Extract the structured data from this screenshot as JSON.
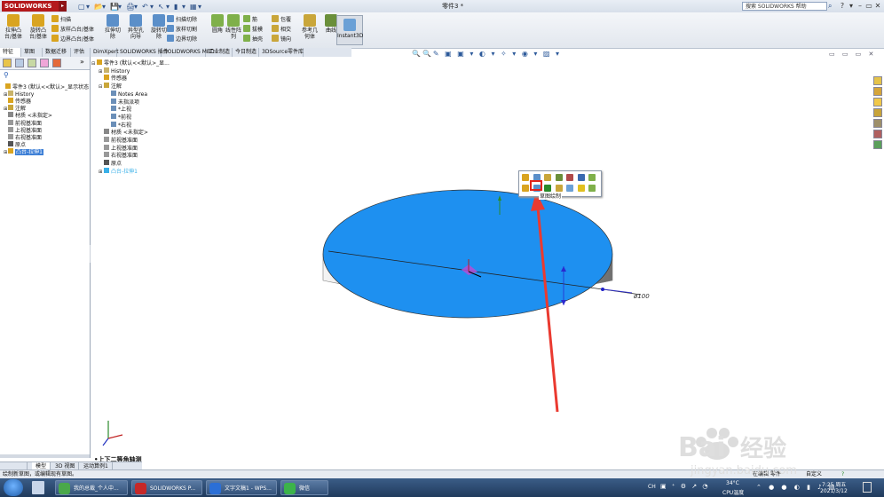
{
  "titlebar": {
    "app_name": "SOLIDWORKS",
    "doc_title": "零件3 *",
    "help_search": "搜索 SOLIDWORKS 帮助",
    "quick_icons": [
      "▢",
      "▾",
      "📂",
      "▾",
      "💾",
      "▾",
      "🖨",
      "▾",
      "↶",
      "▾",
      "↖",
      "▾",
      "▮",
      "▾",
      "▦",
      "▾"
    ],
    "win_controls": [
      "?",
      "▾",
      "–",
      "▭",
      "✕"
    ]
  },
  "cmdbar": {
    "big_tools": [
      {
        "label1": "拉伸凸",
        "label2": "台/基体",
        "color": "#d9a420"
      },
      {
        "label1": "旋转凸",
        "label2": "台/基体",
        "color": "#d9a420"
      },
      {
        "label1": "拉伸切",
        "label2": "除",
        "color": "#5b8fc9"
      },
      {
        "label1": "异型孔",
        "label2": "向导",
        "color": "#5b8fc9"
      },
      {
        "label1": "旋转切",
        "label2": "除",
        "color": "#5b8fc9"
      },
      {
        "label1": "圆角",
        "label2": "",
        "color": "#7fb04a"
      },
      {
        "label1": "线性阵",
        "label2": "列",
        "color": "#7fb04a"
      },
      {
        "label1": "参考几",
        "label2": "何体",
        "color": "#c9a63a"
      },
      {
        "label1": "曲线",
        "label2": "",
        "color": "#6a8f3a"
      }
    ],
    "small_tools": [
      {
        "label": "扫描",
        "color": "#d9a420"
      },
      {
        "label": "放样凸台/基体",
        "color": "#d9a420"
      },
      {
        "label": "边界凸台/基体",
        "color": "#d9a420"
      },
      {
        "label": "扫描切除",
        "color": "#5b8fc9"
      },
      {
        "label": "放样切割",
        "color": "#5b8fc9"
      },
      {
        "label": "边界切除",
        "color": "#5b8fc9"
      },
      {
        "label": "筋",
        "color": "#7fb04a"
      },
      {
        "label": "拔模",
        "color": "#7fb04a"
      },
      {
        "label": "抽壳",
        "color": "#7fb04a"
      },
      {
        "label": "包覆",
        "color": "#c9a63a"
      },
      {
        "label": "相交",
        "color": "#c9a63a"
      },
      {
        "label": "镜向",
        "color": "#c9a63a"
      }
    ],
    "instant3d": "Instant3D"
  },
  "tabs": [
    "特征",
    "草图",
    "数据迁移",
    "评估",
    "DimXpert",
    "SOLIDWORKS 插件",
    "SOLIDWORKS MBD",
    "工业制造",
    "今日制造",
    "3DSource零件库"
  ],
  "hud_icons": "🔍🔍✎ ▣ ▣ ▾ ◐ ▾ ✧ ▾ ◉ ▾ ▨ ▾",
  "viewport_controls": "▭ ▭ ▭ ✕",
  "left_tree": [
    {
      "label": "零件3 (默认<<默认>_显示状态",
      "indent": 0,
      "expander": "",
      "color": "#d9a420",
      "sel": false
    },
    {
      "label": "History",
      "indent": 1,
      "expander": "⊞",
      "color": "#c9b36a",
      "sel": false
    },
    {
      "label": "传感器",
      "indent": 1,
      "expander": "",
      "color": "#d9a420",
      "sel": false
    },
    {
      "label": "注解",
      "indent": 1,
      "expander": "⊞",
      "color": "#c9a63a",
      "sel": false
    },
    {
      "label": "材质 <未指定>",
      "indent": 1,
      "expander": "",
      "color": "#888888",
      "sel": false
    },
    {
      "label": "前视基准面",
      "indent": 1,
      "expander": "",
      "color": "#999999",
      "sel": false
    },
    {
      "label": "上视基准面",
      "indent": 1,
      "expander": "",
      "color": "#999999",
      "sel": false
    },
    {
      "label": "右视基准面",
      "indent": 1,
      "expander": "",
      "color": "#999999",
      "sel": false
    },
    {
      "label": "原点",
      "indent": 1,
      "expander": "",
      "color": "#555555",
      "sel": false
    },
    {
      "label": "凸台-拉伸1",
      "indent": 1,
      "expander": "⊞",
      "color": "#d9a420",
      "sel": true
    }
  ],
  "canvas_tree": [
    {
      "label": "零件3 (默认<<默认>_显...",
      "indent": 0,
      "expander": "⊟",
      "color": "#d9a420"
    },
    {
      "label": "History",
      "indent": 1,
      "expander": "⊞",
      "color": "#c9b36a"
    },
    {
      "label": "传感器",
      "indent": 1,
      "expander": "",
      "color": "#d9a420"
    },
    {
      "label": "注解",
      "indent": 1,
      "expander": "⊟",
      "color": "#c9a63a"
    },
    {
      "label": "Notes Area",
      "indent": 2,
      "expander": "",
      "color": "#6b8fb8"
    },
    {
      "label": "未指派项",
      "indent": 2,
      "expander": "",
      "color": "#6b8fb8"
    },
    {
      "label": "*上视",
      "indent": 2,
      "expander": "",
      "color": "#6b8fb8"
    },
    {
      "label": "*前视",
      "indent": 2,
      "expander": "",
      "color": "#6b8fb8"
    },
    {
      "label": "*右视",
      "indent": 2,
      "expander": "",
      "color": "#6b8fb8"
    },
    {
      "label": "材质 <未指定>",
      "indent": 1,
      "expander": "",
      "color": "#888888"
    },
    {
      "label": "前视基准面",
      "indent": 1,
      "expander": "",
      "color": "#999999"
    },
    {
      "label": "上视基准面",
      "indent": 1,
      "expander": "",
      "color": "#999999"
    },
    {
      "label": "右视基准面",
      "indent": 1,
      "expander": "",
      "color": "#999999"
    },
    {
      "label": "原点",
      "indent": 1,
      "expander": "",
      "color": "#555555"
    },
    {
      "label": "凸台-拉伸1",
      "indent": 1,
      "expander": "⊞",
      "color": "#3ab0e8"
    }
  ],
  "canvas": {
    "tooltip": "草图绘制",
    "view_label": "•上下二等角轴测",
    "dim_label": "ø100",
    "disk_color": "#1e90f0"
  },
  "bottom_tabs": [
    "模型",
    "3D 视图",
    "运动算例1"
  ],
  "statusbar": {
    "left": "绘制新草图，或编辑现有草图。",
    "mid": "在编辑 零件",
    "units": "自定义"
  },
  "taskbar": {
    "tasks": [
      {
        "label": "我的总裁_个人中...",
        "color": "#4aa84a"
      },
      {
        "label": "SOLIDWORKS P...",
        "color": "#c62828"
      },
      {
        "label": "文字文稿1 - WPS...",
        "color": "#2b6fd6"
      },
      {
        "label": "微信",
        "color": "#3cb34a"
      }
    ],
    "weather_temp": "34°C",
    "weather_desc": "CPU温度",
    "time": "7:25 周五",
    "date": "2021/3/12",
    "ime": "CH"
  }
}
